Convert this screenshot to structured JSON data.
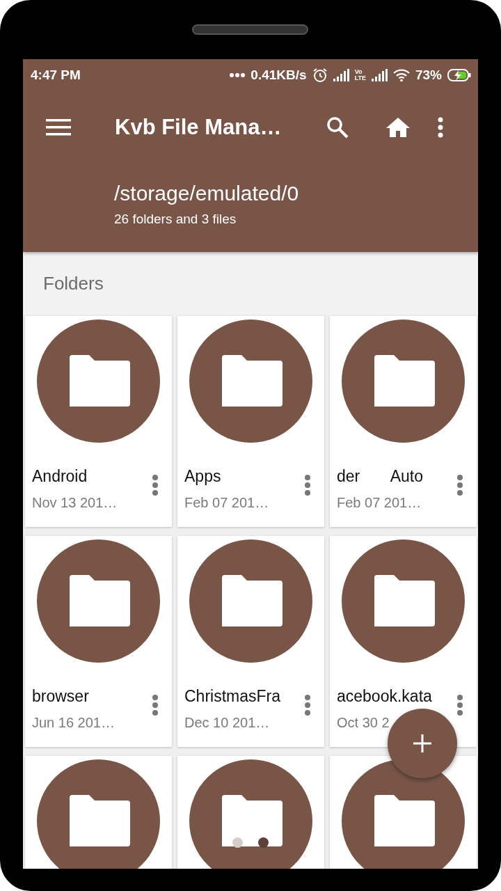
{
  "status_bar": {
    "time": "4:47 PM",
    "speed": "0.41KB/s",
    "volte_top": "Vo",
    "volte_bottom": "LTE",
    "battery": "73%"
  },
  "toolbar": {
    "title": "Kvb File Mana…"
  },
  "path": {
    "location": "/storage/emulated/0",
    "summary": "26 folders and 3 files"
  },
  "section": {
    "title": "Folders"
  },
  "folders": [
    {
      "kind": "labelled",
      "name": "Android",
      "date": "Nov 13 201…"
    },
    {
      "kind": "labelled",
      "name": "Apps",
      "date": "Feb 07 201…"
    },
    {
      "kind": "labelled",
      "name": "der       Auto",
      "date": "Feb 07 201…"
    },
    {
      "kind": "labelled",
      "name": "browser",
      "date": "Jun 16 201…"
    },
    {
      "kind": "labelled",
      "name": "ChristmasFra",
      "date": "Dec 10 201…"
    },
    {
      "kind": "labelled",
      "name": "acebook.kata",
      "date": "Oct 30 2"
    },
    {
      "kind": "icon_only"
    },
    {
      "kind": "icon_only",
      "pager": [
        {
          "selected": false
        },
        {
          "selected": true
        }
      ]
    },
    {
      "kind": "icon_only"
    }
  ]
}
